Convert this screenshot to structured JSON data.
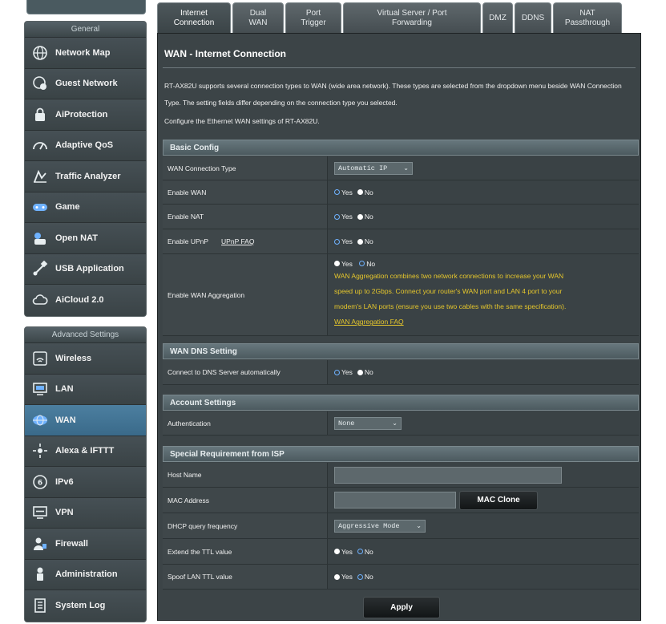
{
  "sidebar": {
    "general_header": "General",
    "general_items": [
      {
        "label": "Network Map",
        "icon": "globe-icon"
      },
      {
        "label": "Guest Network",
        "icon": "guest-network-icon"
      },
      {
        "label": "AiProtection",
        "icon": "lock-icon"
      },
      {
        "label": "Adaptive QoS",
        "icon": "gauge-icon"
      },
      {
        "label": "Traffic Analyzer",
        "icon": "chart-icon"
      },
      {
        "label": "Game",
        "icon": "gamepad-icon"
      },
      {
        "label": "Open NAT",
        "icon": "open-nat-icon"
      },
      {
        "label": "USB Application",
        "icon": "usb-icon"
      },
      {
        "label": "AiCloud 2.0",
        "icon": "cloud-icon"
      }
    ],
    "advanced_header": "Advanced Settings",
    "advanced_items": [
      {
        "label": "Wireless",
        "icon": "wifi-icon"
      },
      {
        "label": "LAN",
        "icon": "monitor-icon"
      },
      {
        "label": "WAN",
        "icon": "globe-icon"
      },
      {
        "label": "Alexa & IFTTT",
        "icon": "alexa-icon"
      },
      {
        "label": "IPv6",
        "icon": "ipv6-icon"
      },
      {
        "label": "VPN",
        "icon": "vpn-icon"
      },
      {
        "label": "Firewall",
        "icon": "firewall-icon"
      },
      {
        "label": "Administration",
        "icon": "person-icon"
      },
      {
        "label": "System Log",
        "icon": "log-icon"
      }
    ],
    "active_item": "WAN"
  },
  "tabs": [
    {
      "line1": "Internet",
      "line2": "Connection"
    },
    {
      "line1": "Dual",
      "line2": "WAN"
    },
    {
      "line1": "Port",
      "line2": "Trigger"
    },
    {
      "line1": "Virtual Server / Port",
      "line2": "Forwarding"
    },
    {
      "line1": "DMZ",
      "line2": ""
    },
    {
      "line1": "DDNS",
      "line2": ""
    },
    {
      "line1": "NAT",
      "line2": "Passthrough"
    }
  ],
  "active_tab": "Internet Connection",
  "page": {
    "title": "WAN - Internet Connection",
    "description": "RT-AX82U supports several connection types to WAN (wide area network). These types are selected from the dropdown menu beside WAN Connection Type. The setting fields differ depending on the connection type you selected.",
    "subtitle": "Configure the Ethernet WAN settings of RT-AX82U."
  },
  "basic": {
    "header": "Basic Config",
    "wan_type_label": "WAN Connection Type",
    "wan_type_value": "Automatic IP",
    "enable_wan_label": "Enable WAN",
    "enable_nat_label": "Enable NAT",
    "enable_upnp_label": "Enable UPnP",
    "upnp_faq": "UPnP FAQ",
    "enable_agg_label": "Enable WAN Aggregation",
    "agg_note_1": "WAN Aggregation combines two network connections to increase your WAN",
    "agg_note_2": "speed up to 2Gbps. Connect your router's WAN port and LAN 4 port to your",
    "agg_note_3": "modem's LAN ports (ensure you use two cables with the same specification).",
    "agg_faq": "WAN Aggregation FAQ"
  },
  "radio": {
    "yes": "Yes",
    "no": "No"
  },
  "dns": {
    "header": "WAN DNS Setting",
    "auto_label": "Connect to DNS Server automatically"
  },
  "account": {
    "header": "Account Settings",
    "auth_label": "Authentication",
    "auth_value": "None"
  },
  "isp": {
    "header": "Special Requirement from ISP",
    "host_label": "Host Name",
    "mac_label": "MAC Address",
    "mac_clone": "MAC Clone",
    "dhcp_label": "DHCP query frequency",
    "dhcp_value": "Aggressive Mode",
    "ttl_label": "Extend the TTL value",
    "spoof_label": "Spoof LAN TTL value"
  },
  "apply_label": "Apply"
}
